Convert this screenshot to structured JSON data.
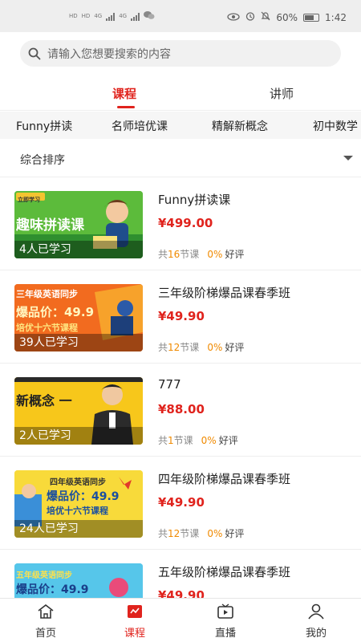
{
  "statusbar": {
    "left_chip_a": "HD",
    "left_chip_b": "HD",
    "net_a": "4G",
    "net_b": "4G",
    "battery": "60%",
    "time": "1:42"
  },
  "search": {
    "placeholder": "请输入您想要搜索的内容"
  },
  "tabs": [
    {
      "label": "课程",
      "active": true
    },
    {
      "label": "讲师",
      "active": false
    }
  ],
  "categories": [
    "Funny拼读",
    "名师培优课",
    "精解新概念",
    "初中数学"
  ],
  "sort": {
    "label": "综合排序"
  },
  "courses": [
    {
      "title": "Funny拼读课",
      "price": "¥499.00",
      "learners": "4人已学习",
      "lessons_prefix": "共",
      "lessons": "16",
      "lessons_suffix": "节课",
      "rating": "0%",
      "rating_label": "好评",
      "thumb_text": "趣味拼读课",
      "thumb_tag": "立即学习"
    },
    {
      "title": "三年级阶梯爆品课春季班",
      "price": "¥49.90",
      "learners": "39人已学习",
      "lessons_prefix": "共",
      "lessons": "12",
      "lessons_suffix": "节课",
      "rating": "0%",
      "rating_label": "好评",
      "thumb_line1": "三年级英语同步",
      "thumb_line2": "爆品价：49.9",
      "thumb_line3": "培优十六节课程"
    },
    {
      "title": "777",
      "price": "¥88.00",
      "learners": "2人已学习",
      "lessons_prefix": "共",
      "lessons": "1",
      "lessons_suffix": "节课",
      "rating": "0%",
      "rating_label": "好评",
      "thumb_text": "新概念 一"
    },
    {
      "title": "四年级阶梯爆品课春季班",
      "price": "¥49.90",
      "learners": "24人已学习",
      "lessons_prefix": "共",
      "lessons": "12",
      "lessons_suffix": "节课",
      "rating": "0%",
      "rating_label": "好评",
      "thumb_line1": "四年级英语同步",
      "thumb_line2": "爆品价：49.9",
      "thumb_line3": "培优十六节课程"
    },
    {
      "title": "五年级阶梯爆品课春季班",
      "price": "¥49.90",
      "thumb_line1": "五年级英语同步",
      "thumb_line2": "爆品价：49.9"
    }
  ],
  "bottom_nav": [
    {
      "label": "首页",
      "icon": "home-icon",
      "active": false
    },
    {
      "label": "课程",
      "icon": "course-icon",
      "active": true
    },
    {
      "label": "直播",
      "icon": "tv-icon",
      "active": false
    },
    {
      "label": "我的",
      "icon": "user-icon",
      "active": false
    }
  ],
  "colors": {
    "accent": "#e0231d",
    "orange": "#f08a00"
  }
}
